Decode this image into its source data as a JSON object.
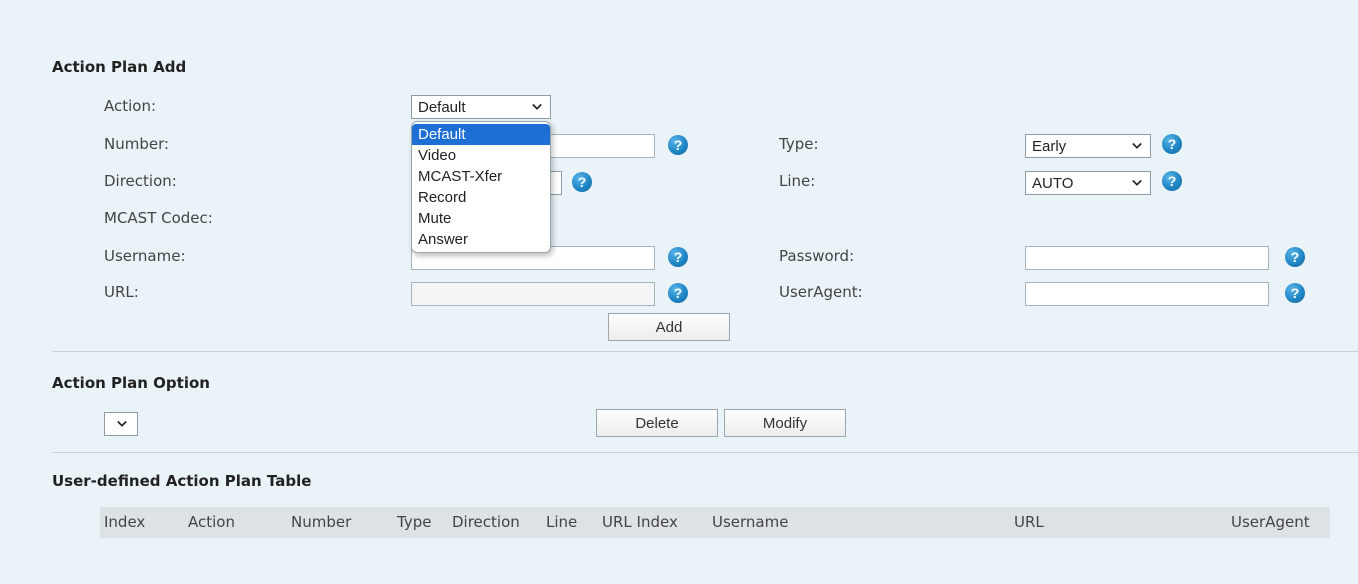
{
  "sections": {
    "add": "Action Plan Add",
    "option": "Action Plan Option",
    "table": "User-defined Action Plan Table"
  },
  "form": {
    "action_label": "Action:",
    "action_value": "Default",
    "number_label": "Number:",
    "number_value": "",
    "direction_label": "Direction:",
    "mcast_label": "MCAST Codec:",
    "username_label": "Username:",
    "username_value": "",
    "url_label": "URL:",
    "url_value": "",
    "type_label": "Type:",
    "type_value": "Early",
    "line_label": "Line:",
    "line_value": "AUTO",
    "password_label": "Password:",
    "password_value": "",
    "useragent_label": "UserAgent:",
    "useragent_value": "",
    "add_button": "Add"
  },
  "action_options": [
    "Default",
    "Video",
    "MCAST-Xfer",
    "Record",
    "Mute",
    "Answer"
  ],
  "option": {
    "select_value": "",
    "delete_button": "Delete",
    "modify_button": "Modify"
  },
  "table": {
    "columns": [
      "Index",
      "Action",
      "Number",
      "Type",
      "Direction",
      "Line",
      "URL Index",
      "Username",
      "URL",
      "UserAgent"
    ]
  },
  "help_glyph": "?",
  "colors": {
    "background": "#eaf3f7",
    "help_icon": "#1f86c5",
    "selected_option": "#1d6fd6",
    "table_header": "#dde2e4"
  }
}
